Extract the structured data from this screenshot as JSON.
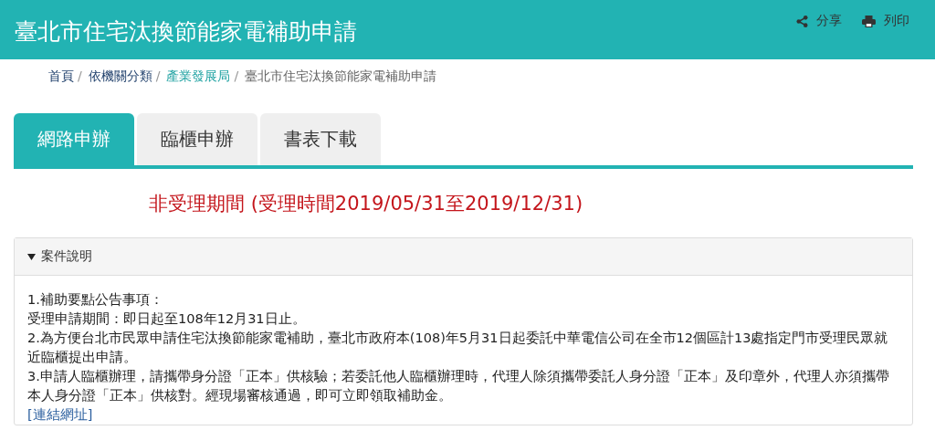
{
  "header": {
    "title": "臺北市住宅汰換節能家電補助申請",
    "actions": [
      {
        "kind": "share",
        "label": "分享"
      },
      {
        "kind": "print",
        "label": "列印"
      }
    ]
  },
  "breadcrumb": [
    {
      "label": "首頁",
      "separator": "/",
      "current": false,
      "highlight": false
    },
    {
      "label": "依機關分類",
      "separator": "/",
      "current": false,
      "highlight": false
    },
    {
      "label": "產業發展局",
      "separator": "/",
      "current": false,
      "highlight": true
    },
    {
      "label": "臺北市住宅汰換節能家電補助申請",
      "current": true,
      "highlight": false
    }
  ],
  "tabs": [
    {
      "label": "網路申辦",
      "selected": true
    },
    {
      "label": "臨櫃申辦",
      "selected": false
    },
    {
      "label": "書表下載",
      "selected": false
    }
  ],
  "notice": "非受理期間 (受理時間2019/05/31至2019/12/31)",
  "panel": {
    "title": "案件說明",
    "expanded": true,
    "paragraphs": [
      "1.補助要點公告事項：",
      "受理申請期間：即日起至108年12月31日止。",
      "2.為方便台北市民眾申請住宅汰換節能家電補助，臺北市政府本(108)年5月31日起委託中華電信公司在全市12個區計13處指定門市受理民眾就近臨櫃提出申請。",
      "3.申請人臨櫃辦理，請攜帶身分證「正本」供核驗；若委託他人臨櫃辦理時，代理人除須攜帶委託人身分證「正本」及印章外，代理人亦須攜帶本人身分證「正本」供核對。經現場審核通過，即可立即領取補助金。"
    ],
    "link": "[連結網址]"
  }
}
